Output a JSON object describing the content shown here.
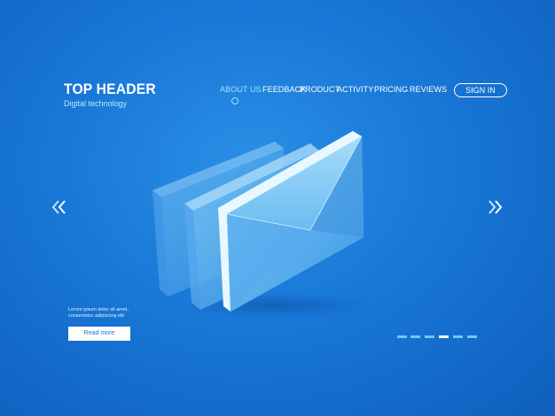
{
  "brand": {
    "title": "TOP HEADER",
    "subtitle": "Digital technology"
  },
  "nav": {
    "items": [
      {
        "label": "ABOUT US",
        "active": true
      },
      {
        "label": "FEEDBACK"
      },
      {
        "label": "PRODUCT"
      },
      {
        "label": "ACTIVITY"
      },
      {
        "label": "PRICING"
      },
      {
        "label": "REVIEWS"
      }
    ],
    "signin_label": "SIGN IN"
  },
  "hero": {
    "icon": "envelope-stack-icon",
    "prev_icon": "chevron-double-left-icon",
    "next_icon": "chevron-double-right-icon"
  },
  "content": {
    "body": "Lorem ipsum dolor sit amet, consectetur adipiscing elit",
    "button_label": "Read more"
  },
  "pager": {
    "count": 6,
    "active_index": 3
  },
  "colors": {
    "background": "#1877d6",
    "accent": "#9fe0ff",
    "button_bg": "#ffffff",
    "button_text": "#1a74d2",
    "pager": "#6fc8ff"
  }
}
